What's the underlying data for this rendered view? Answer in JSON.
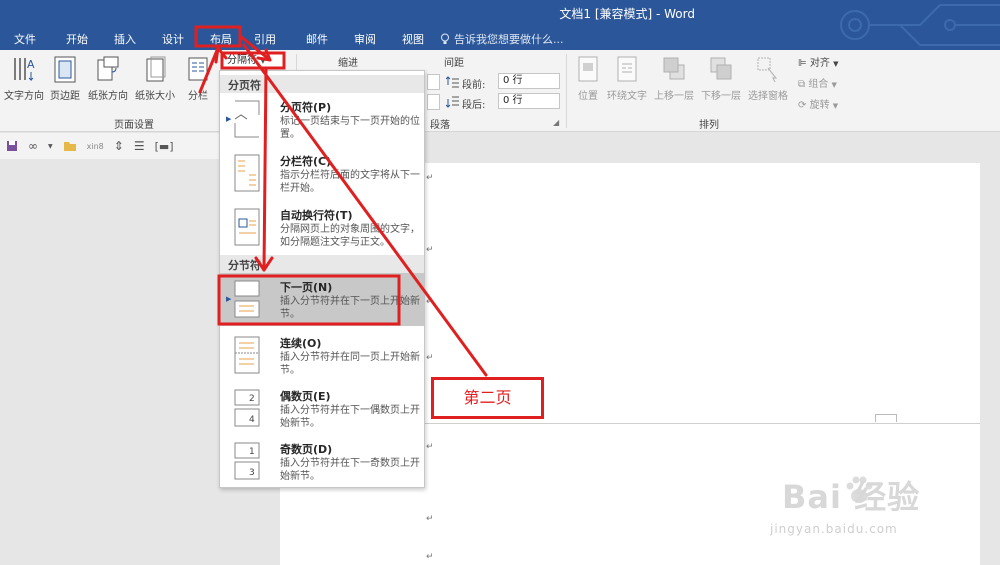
{
  "window": {
    "title": "文档1 [兼容模式] - Word"
  },
  "tabs": [
    "文件",
    "开始",
    "插入",
    "设计",
    "布局",
    "引用",
    "邮件",
    "审阅",
    "视图"
  ],
  "tell_me": "告诉我您想要做什么...",
  "ribbon": {
    "page_setup": {
      "buttons": [
        "文字方向",
        "页边距",
        "纸张方向",
        "纸张大小",
        "分栏"
      ],
      "breaks_button": "分隔符",
      "group_label": "页面设置"
    },
    "paragraph": {
      "indent_label": "缩进",
      "spacing_label": "间距",
      "before_label": "段前:",
      "before_value": "0 行",
      "after_label": "段后:",
      "after_value": "0 行",
      "group_label": "段落"
    },
    "arrange": {
      "buttons": [
        "位置",
        "环绕文字",
        "上移一层",
        "下移一层",
        "选择窗格"
      ],
      "side": [
        "对齐",
        "组合",
        "旋转"
      ],
      "group_label": "排列"
    }
  },
  "qat": {
    "file_label": "xin8"
  },
  "dropdown": {
    "page_breaks_header": "分页符",
    "section_breaks_header": "分节符",
    "items": [
      {
        "title": "分页符(P)",
        "desc": "标记一页结束与下一页开始的位置。"
      },
      {
        "title": "分栏符(C)",
        "desc": "指示分栏符后面的文字将从下一栏开始。"
      },
      {
        "title": "自动换行符(T)",
        "desc": "分隔网页上的对象周围的文字，如分隔题注文字与正文。"
      },
      {
        "title": "下一页(N)",
        "desc": "插入分节符并在下一页上开始新节。"
      },
      {
        "title": "连续(O)",
        "desc": "插入分节符并在同一页上开始新节。"
      },
      {
        "title": "偶数页(E)",
        "desc": "插入分节符并在下一偶数页上开始新节。"
      },
      {
        "title": "奇数页(D)",
        "desc": "插入分节符并在下一奇数页上开始新节。"
      }
    ]
  },
  "annotation": {
    "callout": "第二页",
    "color": "#e02020"
  },
  "watermark": {
    "main": "Bai 经验",
    "sub": "jingyan.baidu.com"
  },
  "colors": {
    "title_bar": "#2b579a",
    "ribbon": "#f3f3f3",
    "accent": "#e02020"
  }
}
